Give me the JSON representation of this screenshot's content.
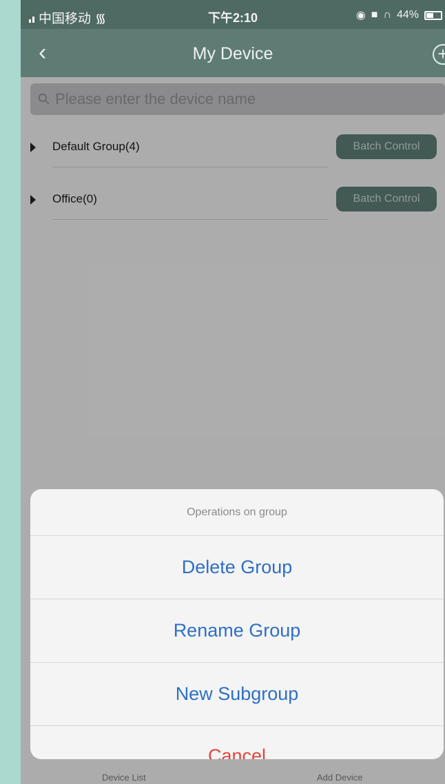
{
  "status_bar": {
    "carrier": "中国移动",
    "time": "下午2:10",
    "battery": "44%"
  },
  "nav": {
    "title": "My Device",
    "back_icon": "chevron-left-icon",
    "add_icon": "plus-circle-icon"
  },
  "search": {
    "placeholder": "Please enter the device name"
  },
  "groups": [
    {
      "name": "Default Group(4)",
      "button": "Batch Control"
    },
    {
      "name": "Office(0)",
      "button": "Batch Control"
    }
  ],
  "tabbar": {
    "left": "Device List",
    "right": "Add Device"
  },
  "action_sheet": {
    "title": "Operations on group",
    "actions": [
      "Delete Group",
      "Rename Group",
      "New Subgroup"
    ],
    "cancel": "Cancel"
  },
  "colors": {
    "nav": "#5e7b74",
    "accent": "#2f6fc4",
    "destructive": "#e0463c",
    "batch_button": "#5a7872",
    "outer_background": "#a9d9cf"
  }
}
